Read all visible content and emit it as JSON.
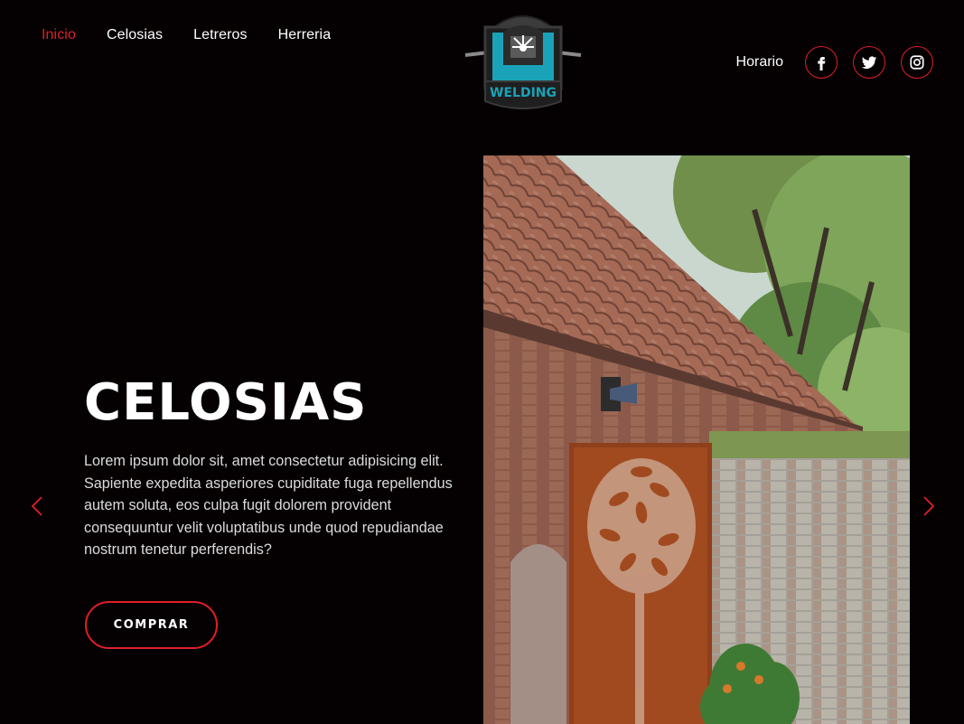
{
  "nav": {
    "items": [
      {
        "label": "Inicio",
        "active": true
      },
      {
        "label": "Celosias",
        "active": false
      },
      {
        "label": "Letreros",
        "active": false
      },
      {
        "label": "Herreria",
        "active": false
      }
    ]
  },
  "logo": {
    "text": "WELDING"
  },
  "header_right": {
    "horario_label": "Horario",
    "social_icons": [
      "facebook-icon",
      "twitter-icon",
      "instagram-icon"
    ]
  },
  "hero": {
    "title": "CELOSIAS",
    "text": "Lorem ipsum dolor sit, amet consectetur adipisicing elit. Sapiente expedita asperiores cupiditate fuga repellendus autem soluta, eos culpa fugit dolorem provident consequuntur velit voluptatibus unde quod repudiandae nostrum tenetur perferendis?",
    "button_label": "COMPRAR"
  },
  "colors": {
    "accent": "#e01f26",
    "background": "#050103",
    "logo_teal": "#1aa3b8"
  }
}
